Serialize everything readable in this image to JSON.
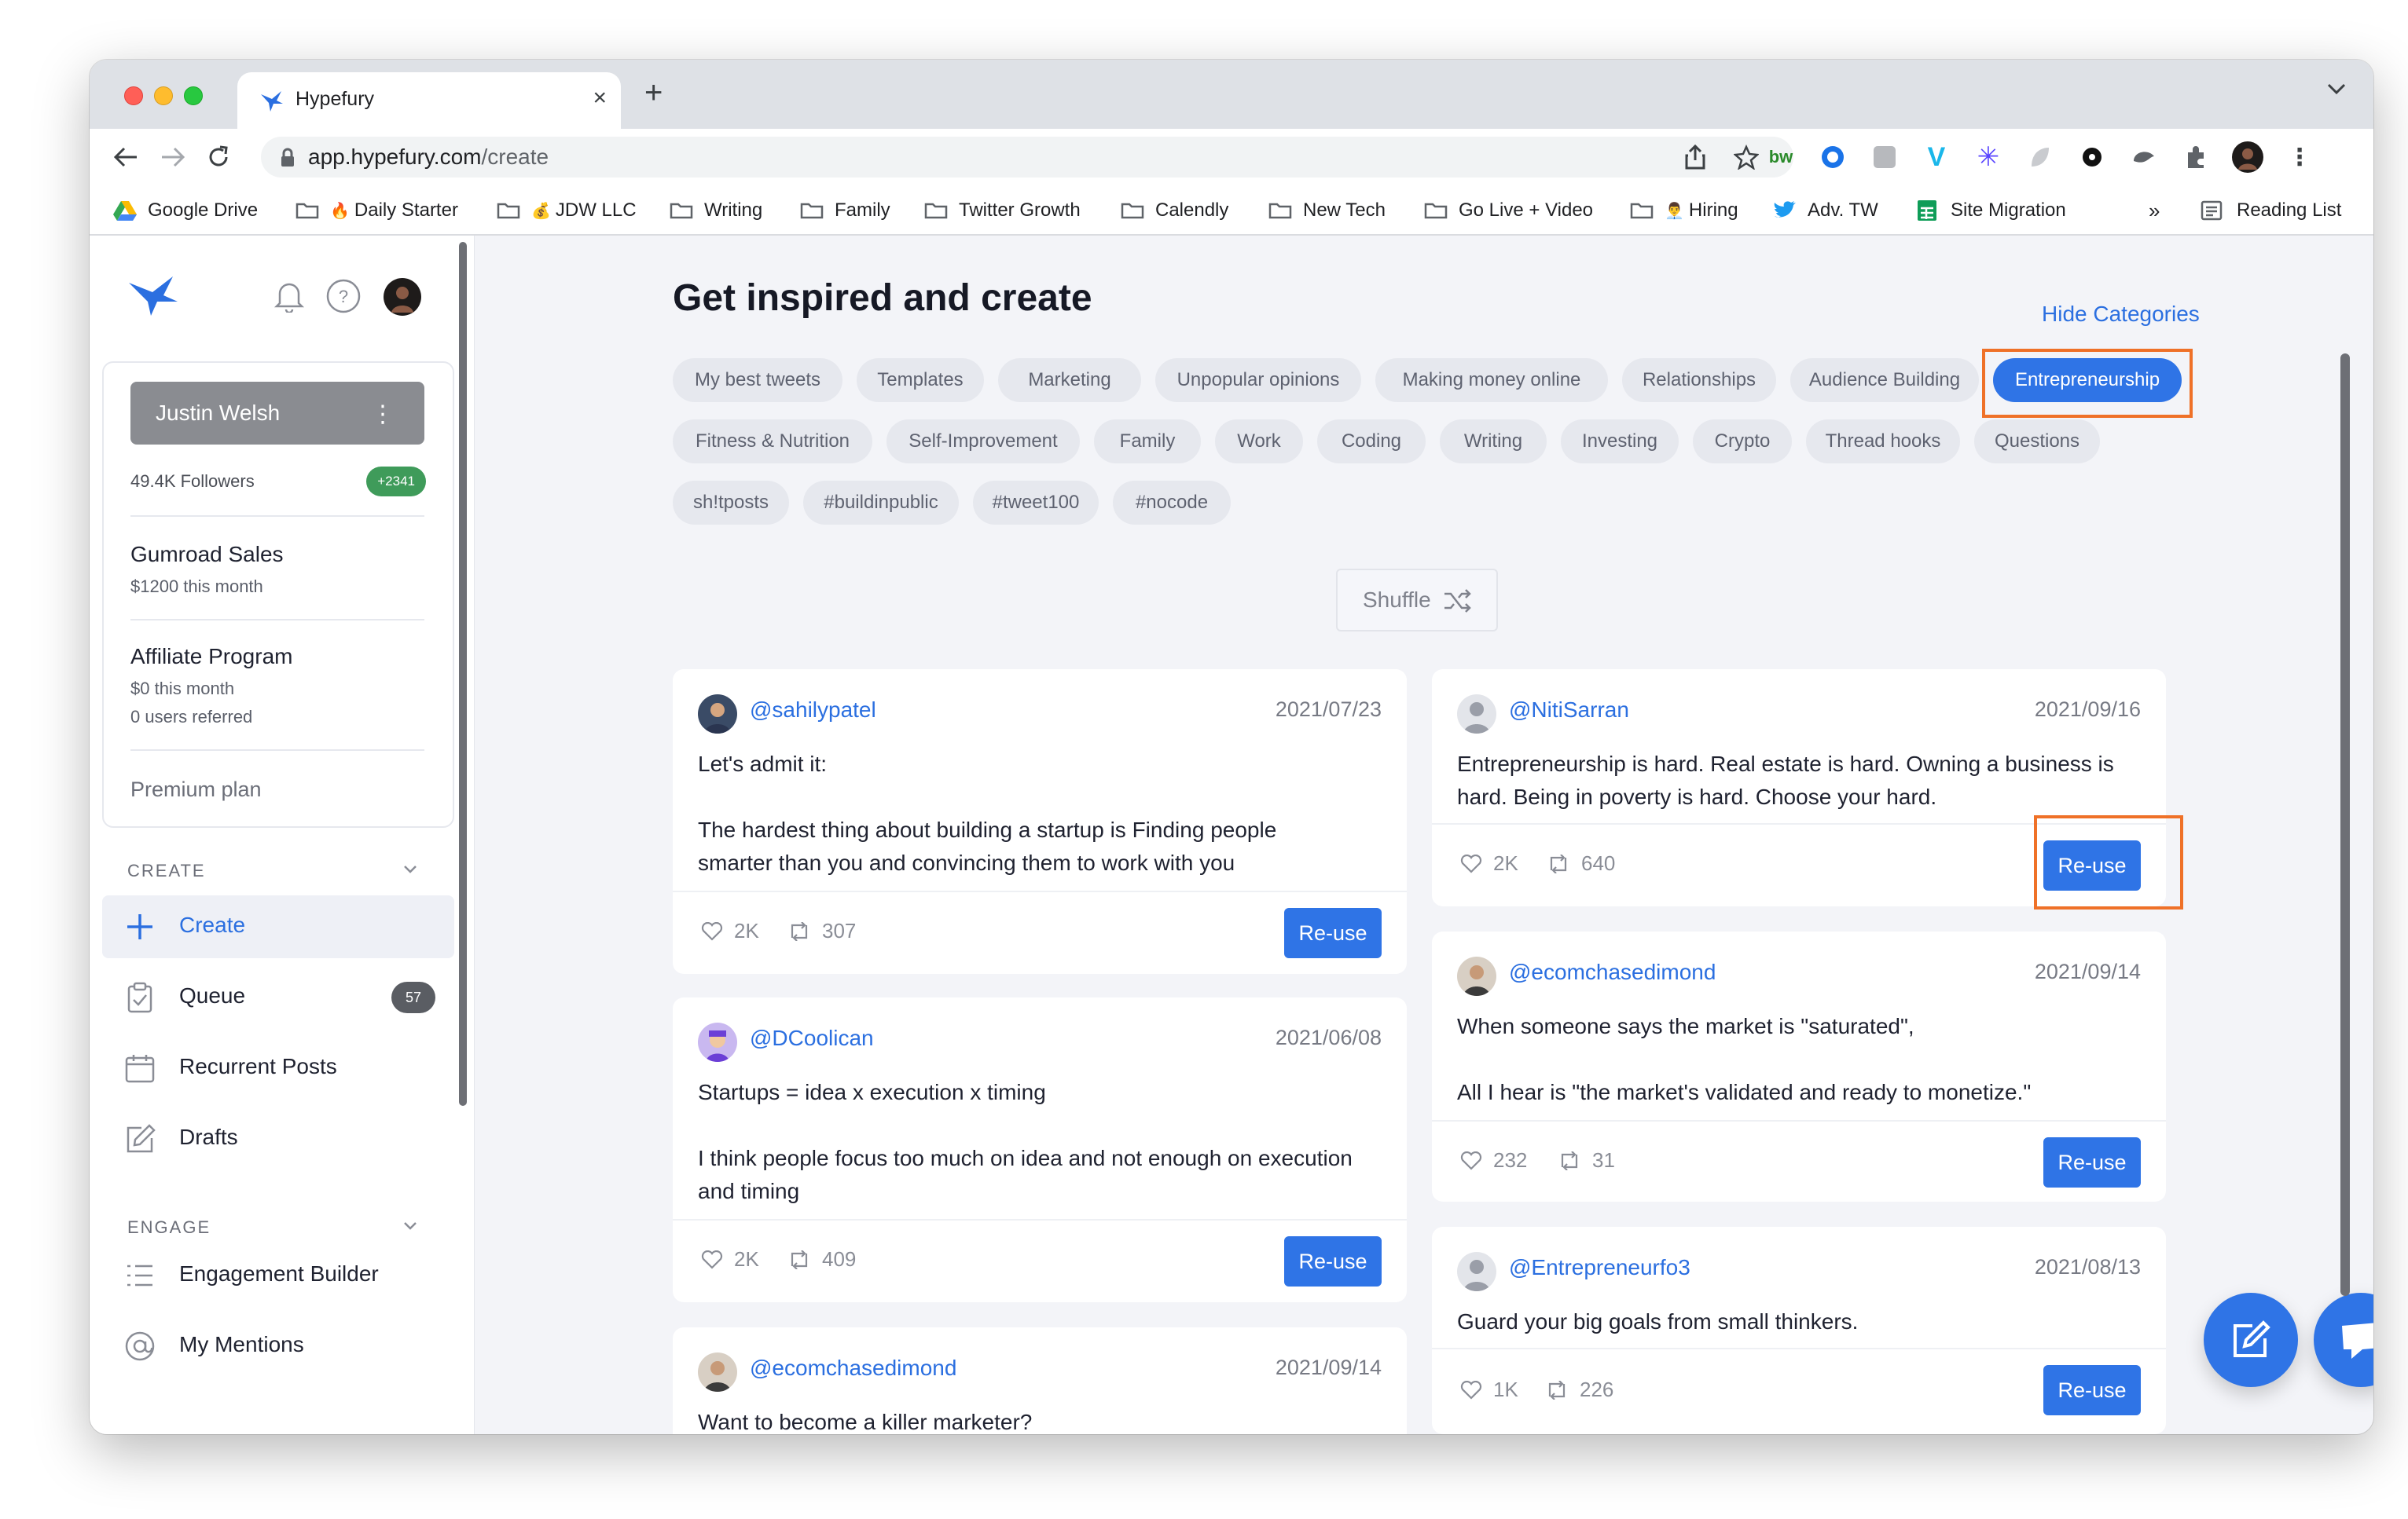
{
  "browser": {
    "tab_title": "Hypefury",
    "url_domain": "app.hypefury.com",
    "url_path": "/create",
    "bookmarks": [
      {
        "label": "Google Drive",
        "icon": "google-drive-icon"
      },
      {
        "label": "Daily Starter",
        "emoji": "🔥"
      },
      {
        "label": "JDW LLC",
        "emoji": "💰"
      },
      {
        "label": "Writing"
      },
      {
        "label": "Family"
      },
      {
        "label": "Twitter Growth"
      },
      {
        "label": "Calendly"
      },
      {
        "label": "New Tech"
      },
      {
        "label": "Go Live + Video"
      },
      {
        "label": "Hiring",
        "emoji": "👨‍💼"
      },
      {
        "label": "Adv. TW",
        "icon": "twitter-bird-icon"
      },
      {
        "label": "Site Migration",
        "icon": "google-sheets-icon"
      }
    ],
    "bookmarks_overflow": "»",
    "reading_list": "Reading List"
  },
  "sidebar": {
    "account": {
      "name": "Justin Welsh",
      "followers": "49.4K Followers",
      "followers_delta": "+2341"
    },
    "gumroad": {
      "title": "Gumroad Sales",
      "sub": "$1200 this month"
    },
    "affiliate": {
      "title": "Affiliate Program",
      "line1": "$0 this month",
      "line2": "0 users referred"
    },
    "premium": "Premium plan",
    "create_heading": "CREATE",
    "create_items": [
      {
        "label": "Create",
        "icon": "plus-icon"
      },
      {
        "label": "Queue",
        "icon": "clipboard-icon",
        "count": "57"
      },
      {
        "label": "Recurrent Posts",
        "icon": "calendar-icon"
      },
      {
        "label": "Drafts",
        "icon": "edit-icon"
      }
    ],
    "engage_heading": "ENGAGE",
    "engage_items": [
      {
        "label": "Engagement Builder",
        "icon": "list-icon"
      },
      {
        "label": "My Mentions",
        "icon": "at-icon"
      }
    ]
  },
  "main": {
    "title": "Get inspired and create",
    "hide_categories": "Hide Categories",
    "categories": [
      "My best tweets",
      "Templates",
      "Marketing",
      "Unpopular opinions",
      "Making money online",
      "Relationships",
      "Audience Building",
      "Entrepreneurship",
      "Fitness & Nutrition",
      "Self-Improvement",
      "Family",
      "Work",
      "Coding",
      "Writing",
      "Investing",
      "Crypto",
      "Thread hooks",
      "Questions",
      "sh!tposts",
      "#buildinpublic",
      "#tweet100",
      "#nocode"
    ],
    "active_category": "Entrepreneurship",
    "shuffle": "Shuffle",
    "reuse_label": "Re-use",
    "tweets": [
      {
        "handle": "@sahilypatel",
        "date": "2021/07/23",
        "lines": [
          "Let's admit it:",
          "",
          "The hardest thing about building a startup is Finding people",
          "smarter than you and convincing them to work with you"
        ],
        "likes": "2K",
        "retweets": "307"
      },
      {
        "handle": "@DCoolican",
        "date": "2021/06/08",
        "lines": [
          "Startups = idea x execution x timing",
          "",
          "I think people focus too much on idea and not enough on execution",
          "and timing"
        ],
        "likes": "2K",
        "retweets": "409"
      },
      {
        "handle": "@ecomchasedimond",
        "date": "2021/09/14",
        "lines": [
          "Want to become a killer marketer?"
        ]
      },
      {
        "handle": "@NitiSarran",
        "date": "2021/09/16",
        "lines": [
          "Entrepreneurship is hard. Real estate is hard. Owning a business is",
          "hard. Being in poverty is hard. Choose your hard."
        ],
        "likes": "2K",
        "retweets": "640"
      },
      {
        "handle": "@ecomchasedimond",
        "date": "2021/09/14",
        "lines": [
          "When someone says the market is \"saturated\",",
          "",
          "All I hear is \"the market's validated and ready to monetize.\""
        ],
        "likes": "232",
        "retweets": "31"
      },
      {
        "handle": "@Entrepreneurfo3",
        "date": "2021/08/13",
        "lines": [
          "Guard your big goals from small thinkers."
        ],
        "likes": "1K",
        "retweets": "226"
      }
    ]
  },
  "colors": {
    "accent": "#2f74e6",
    "highlight": "#ef7128",
    "badge": "#3f9b5a"
  }
}
